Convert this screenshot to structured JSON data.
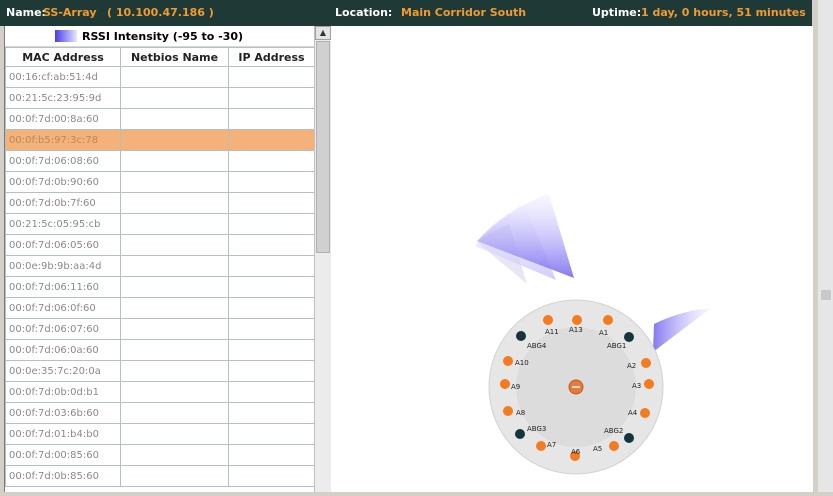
{
  "header": {
    "name_label": "Name:",
    "name_value": "SS-Array",
    "ip_value": "( 10.100.47.186 )",
    "location_label": "Location:",
    "location_value": "Main Corridor South",
    "uptime_label": "Uptime:",
    "uptime_value": "1 day, 0 hours, 51 minutes"
  },
  "legend": {
    "label": "RSSI Intensity (-95 to -30)"
  },
  "table": {
    "columns": [
      "MAC Address",
      "Netbios Name",
      "IP Address"
    ],
    "rows": [
      {
        "mac": "00:16:cf:ab:51:4d"
      },
      {
        "mac": "00:21:5c:23:95:9d"
      },
      {
        "mac": "00:0f:7d:00:8a:60"
      },
      {
        "mac": "00:0f:b5:97:3c:78",
        "selected": true
      },
      {
        "mac": "00:0f:7d:06:08:60"
      },
      {
        "mac": "00:0f:7d:0b:90:60"
      },
      {
        "mac": "00:0f:7d:0b:7f:60"
      },
      {
        "mac": "00:21:5c:05:95:cb"
      },
      {
        "mac": "00:0f:7d:06:05:60"
      },
      {
        "mac": "00:0e:9b:9b:aa:4d"
      },
      {
        "mac": "00:0f:7d:06:11:60"
      },
      {
        "mac": "00:0f:7d:06:0f:60"
      },
      {
        "mac": "00:0f:7d:06:07:60"
      },
      {
        "mac": "00:0f:7d:06:0a:60"
      },
      {
        "mac": "00:0e:35:7c:20:0a"
      },
      {
        "mac": "00:0f:7d:0b:0d:b1"
      },
      {
        "mac": "00:0f:7d:03:6b:60"
      },
      {
        "mac": "00:0f:7d:01:b4:b0"
      },
      {
        "mac": "00:0f:7d:00:85:60"
      },
      {
        "mac": "00:0f:7d:0b:85:60"
      }
    ]
  },
  "radar": {
    "rssi": [
      {
        "value": "-77"
      },
      {
        "value": "-89"
      },
      {
        "value": "-77"
      }
    ],
    "antenna_labels": [
      "A13",
      "A1",
      "ABG1",
      "A2",
      "A3",
      "A4",
      "ABG2",
      "A5",
      "A6",
      "A7",
      "ABG3",
      "A8",
      "A9",
      "A10",
      "ABG4",
      "A11"
    ]
  },
  "colors": {
    "header_bg": "#1f3a36",
    "header_accent": "#f29a2e",
    "selected_row": "#f4b27a",
    "rssi_high": "#4a3ee6",
    "rssi_low": "#e8e6ff",
    "antenna_dot": "#f47b20",
    "abg_dot": "#14363a"
  }
}
